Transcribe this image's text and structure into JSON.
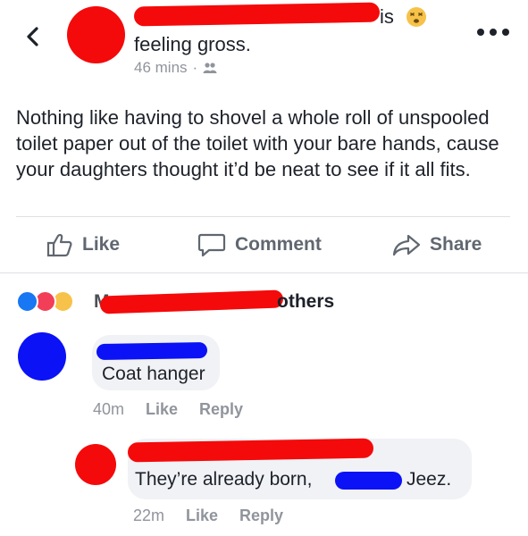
{
  "header": {
    "back_icon": "chevron-left-icon",
    "status_verb": "is",
    "feeling": "feeling gross.",
    "time": "46 mins",
    "audience_icon": "friends-icon",
    "separator": "·",
    "more_icon": "more-dots-icon"
  },
  "post": {
    "text": "Nothing like having to shovel a whole roll of unspooled toilet paper out of the toilet with your bare hands, cause your daughters thought it’d be neat to see if it all fits."
  },
  "actions": {
    "like": "Like",
    "comment": "Comment",
    "share": "Share"
  },
  "reactions": {
    "names_prefix": "Mo",
    "others": "others"
  },
  "comments": [
    {
      "text": "Coat hanger",
      "time": "40m",
      "like": "Like",
      "reply": "Reply"
    },
    {
      "text_before": "They’re already born,",
      "text_after": "Jeez.",
      "time": "22m",
      "like": "Like",
      "reply": "Reply"
    }
  ],
  "colors": {
    "redaction_red": "#f40a0a",
    "redaction_blue": "#0b12f5",
    "muted": "#90949c",
    "bubble": "#f1f2f6"
  }
}
